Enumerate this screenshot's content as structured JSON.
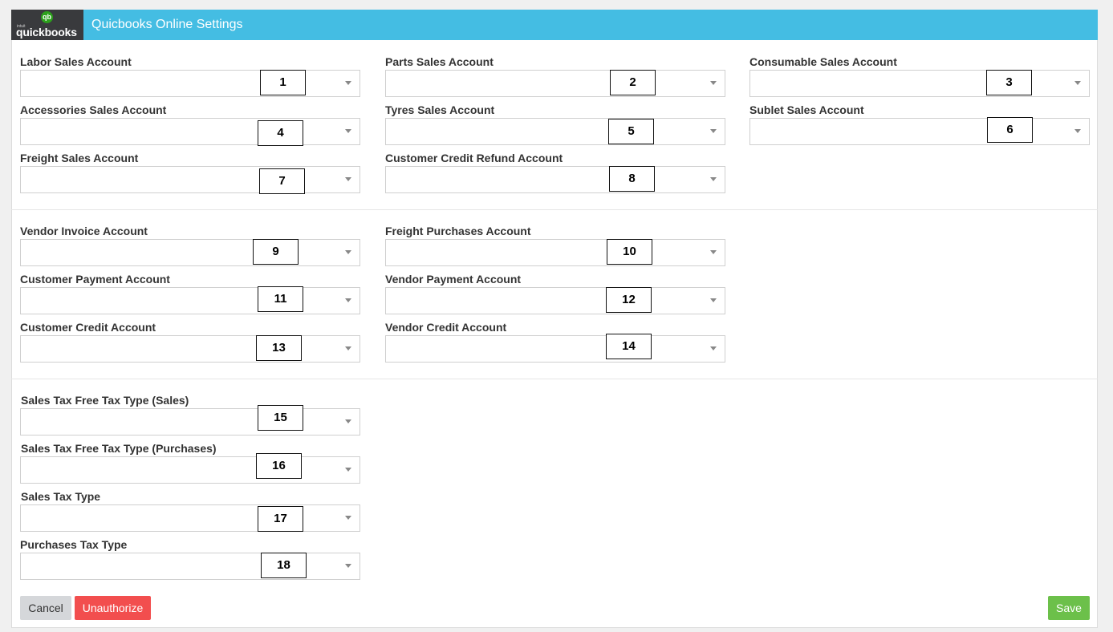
{
  "header": {
    "logo_intuit": "intuit",
    "logo_text": "quickbooks",
    "logo_mark": "qb",
    "title": "Quicbooks Online Settings"
  },
  "fields": [
    {
      "label": "Labor Sales Account",
      "number": "1"
    },
    {
      "label": "Parts Sales Account",
      "number": "2"
    },
    {
      "label": "Consumable Sales Account",
      "number": "3"
    },
    {
      "label": "Accessories Sales Account",
      "number": "4"
    },
    {
      "label": "Tyres Sales Account",
      "number": "5"
    },
    {
      "label": "Sublet Sales Account",
      "number": "6"
    },
    {
      "label": "Freight Sales Account",
      "number": "7"
    },
    {
      "label": "Customer Credit Refund Account",
      "number": "8"
    },
    {
      "label": "Vendor Invoice Account",
      "number": "9"
    },
    {
      "label": "Freight Purchases Account",
      "number": "10"
    },
    {
      "label": "Customer Payment Account",
      "number": "11"
    },
    {
      "label": "Vendor Payment Account",
      "number": "12"
    },
    {
      "label": "Customer Credit Account",
      "number": "13"
    },
    {
      "label": "Vendor Credit Account",
      "number": "14"
    },
    {
      "label": "Sales Tax Free Tax Type (Sales)",
      "number": "15"
    },
    {
      "label": "Sales Tax Free Tax Type (Purchases)",
      "number": "16"
    },
    {
      "label": "Sales Tax Type",
      "number": "17"
    },
    {
      "label": "Purchases Tax Type",
      "number": "18"
    }
  ],
  "buttons": {
    "cancel": "Cancel",
    "unauthorize": "Unauthorize",
    "save": "Save"
  },
  "colors": {
    "header": "#44bde3",
    "cancel": "#d5d7da",
    "unauthorize": "#f24e4e",
    "save": "#6cc04a"
  }
}
